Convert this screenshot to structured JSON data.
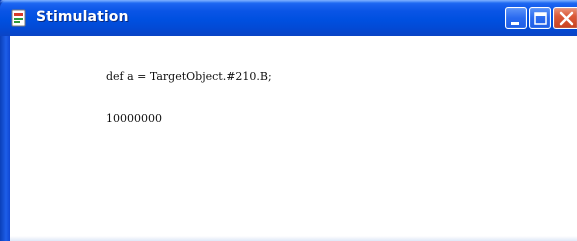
{
  "window": {
    "title": "Stimulation",
    "app_icon": "document-app-icon",
    "controls": {
      "minimize_icon": "minimize-icon",
      "maximize_icon": "maximize-icon",
      "close_icon": "close-icon"
    },
    "colors": {
      "titlebar": "#0050e0",
      "close_button": "#db5a3a",
      "client_background": "#ffffff"
    }
  },
  "content": {
    "lines": [
      "def a = TargetObject.#210.B;",
      "10000000"
    ]
  }
}
